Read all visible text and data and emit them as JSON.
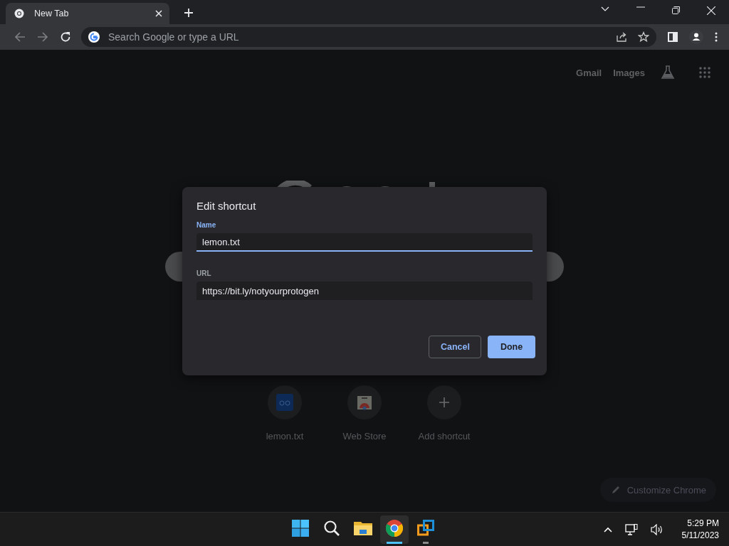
{
  "tabs": [
    {
      "title": "New Tab",
      "selected": true
    }
  ],
  "address_bar": {
    "placeholder": "Search Google or type a URL"
  },
  "header_links": [
    "Gmail",
    "Images"
  ],
  "shortcuts": [
    {
      "title": "lemon.txt",
      "kind": "site"
    },
    {
      "title": "Web Store",
      "kind": "store"
    },
    {
      "title": "Add shortcut",
      "kind": "add"
    }
  ],
  "customize_button": "Customize Chrome",
  "dialog": {
    "title": "Edit shortcut",
    "fields": [
      {
        "label": "Name",
        "value": "lemon.txt",
        "focused": true
      },
      {
        "label": "URL",
        "value": "https://bit.ly/notyourprotogen",
        "focused": false
      }
    ],
    "buttons": [
      {
        "label": "Cancel",
        "kind": "secondary"
      },
      {
        "label": "Done",
        "kind": "primary"
      }
    ]
  },
  "taskbar": {
    "apps": [
      {
        "kind": "start",
        "selected": false,
        "running": false
      },
      {
        "kind": "search",
        "selected": false,
        "running": false
      },
      {
        "kind": "folder",
        "selected": false,
        "running": false
      },
      {
        "kind": "browser",
        "selected": true,
        "running": true
      },
      {
        "kind": "vm",
        "selected": false,
        "running": true
      }
    ],
    "time": "5:29 PM",
    "date": "5/11/2023"
  }
}
